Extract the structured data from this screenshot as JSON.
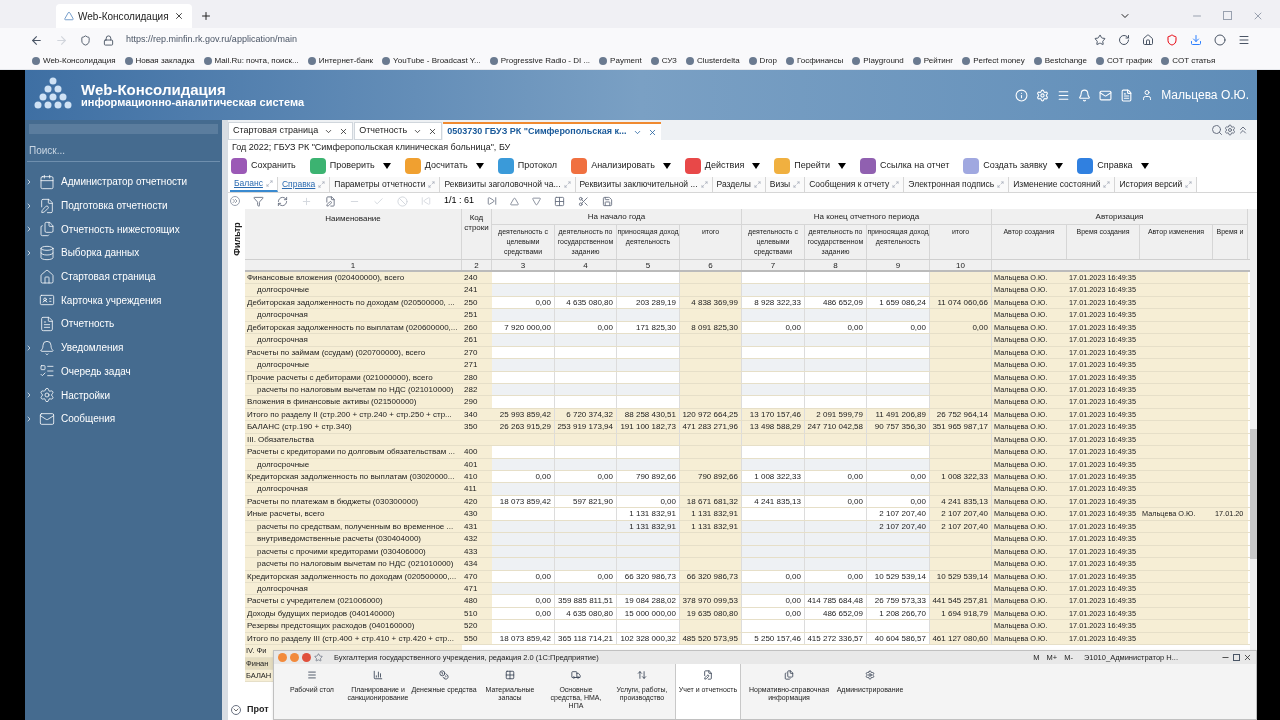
{
  "browser": {
    "tab_title": "Web-Консолидация",
    "url": "https://rep.minfin.rk.gov.ru/application/main",
    "bookmarks": [
      "Web-Консолидация",
      "Новая закладка",
      "Mail.Ru: почта, поиск...",
      "Интернет-банк",
      "YouTube - Broadcast Y...",
      "Progressive Radio - DI ...",
      "Payment",
      "СУЗ",
      "Clusterdelta",
      "Drop",
      "Госфинансы",
      "Playground",
      "Рейтинг",
      "Perfect money",
      "Bestchange",
      "СОТ график",
      "СОТ статья"
    ]
  },
  "app": {
    "title": "Web-Консолидация",
    "subtitle": "информационно-аналитическая система",
    "user": "Мальцева О.Ю."
  },
  "sidebar": {
    "search_placeholder": "Поиск...",
    "items": [
      {
        "label": "Администратор отчетности",
        "expanded": false
      },
      {
        "label": "Подготовка отчетности",
        "expanded": false
      },
      {
        "label": "Отчетность нижестоящих",
        "expanded": false
      },
      {
        "label": "Выборка данных",
        "expanded": false
      },
      {
        "label": "Стартовая страница"
      },
      {
        "label": "Карточка учреждения"
      },
      {
        "label": "Отчетность"
      },
      {
        "label": "Уведомления",
        "expanded": false
      },
      {
        "label": "Очередь задач"
      },
      {
        "label": "Настройки",
        "expanded": false
      },
      {
        "label": "Сообщения",
        "expanded": false
      }
    ]
  },
  "doc_tabs": [
    {
      "label": "Стартовая страница",
      "selected": false
    },
    {
      "label": "Отчетность",
      "selected": false
    },
    {
      "label": "0503730 ГБУЗ РК \"Симферопольская к...",
      "selected": true
    }
  ],
  "info": "Год 2022; ГБУЗ РК \"Симферопольская клиническая больница\", БУ",
  "toolbar": [
    {
      "label": "Сохранить",
      "color": "#9b59b6",
      "dropdown": false
    },
    {
      "label": "Проверить",
      "color": "#3cb371",
      "dropdown": true
    },
    {
      "label": "Досчитать",
      "color": "#f0a030",
      "dropdown": true
    },
    {
      "label": "Протокол",
      "color": "#3a9ad9",
      "dropdown": false
    },
    {
      "label": "Анализировать",
      "color": "#f07040",
      "dropdown": true
    },
    {
      "label": "Действия",
      "color": "#e84848",
      "dropdown": true
    },
    {
      "label": "Перейти",
      "color": "#f0b040",
      "dropdown": true
    },
    {
      "label": "Ссылка на отчет",
      "color": "#9060b0",
      "dropdown": false
    },
    {
      "label": "Создать заявку",
      "color": "#a0a8e0",
      "dropdown": true
    },
    {
      "label": "Справка",
      "color": "#3080e0",
      "dropdown": true
    }
  ],
  "form_tabs": [
    {
      "label": "Баланс",
      "kind": "link",
      "selected": true
    },
    {
      "label": "Справка",
      "kind": "link",
      "selected": false
    },
    {
      "label": "Параметры отчетности",
      "kind": "plain",
      "selected": false
    },
    {
      "label": "Реквизиты заголовочной ча...",
      "kind": "plain",
      "selected": false
    },
    {
      "label": "Реквизиты заключительной ...",
      "kind": "plain",
      "selected": false
    },
    {
      "label": "Разделы",
      "kind": "plain",
      "selected": false
    },
    {
      "label": "Визы",
      "kind": "plain",
      "selected": false
    },
    {
      "label": "Сообщения к отчету",
      "kind": "plain",
      "selected": false
    },
    {
      "label": "Электронная подпись",
      "kind": "plain",
      "selected": false
    },
    {
      "label": "Изменение состояний",
      "kind": "plain",
      "selected": false
    },
    {
      "label": "История версий",
      "kind": "plain",
      "selected": false
    }
  ],
  "pager": "1/1 : 61",
  "filter_label": "Фильтр",
  "table": {
    "name_header": "Наименование",
    "code_header": "Код строки",
    "groups": [
      {
        "label": "На начало года",
        "columns": [
          "деятельность с целевыми средствами",
          "деятельность по государственном заданию",
          "приносящая доход деятельность",
          "итого"
        ]
      },
      {
        "label": "На конец отчетного периода",
        "columns": [
          "деятельность с целевыми средствами",
          "деятельность по государственном заданию",
          "приносящая доход деятельность",
          "итого"
        ]
      },
      {
        "label": "Авторизация",
        "columns": [
          "Автор создания",
          "Время создания",
          "Автор изменения",
          "Время и"
        ]
      }
    ],
    "numbers": [
      "1",
      "2",
      "3",
      "4",
      "5",
      "6",
      "7",
      "8",
      "9",
      "10"
    ],
    "rows": [
      {
        "kind": "item",
        "name": "Финансовые вложения (020400000), всего",
        "code": "240",
        "author": "Мальцева О.Ю.",
        "created": "17.01.2023 16:49:35",
        "children": [
          {
            "kind": "item",
            "name": "долгосрочные",
            "code": "241",
            "author": "Мальцева О.Ю.",
            "created": "17.01.2023 16:49:35"
          }
        ]
      },
      {
        "kind": "item",
        "name": "Дебиторская задолженность по доходам (020500000, ...",
        "code": "250",
        "values": [
          "0,00",
          "4 635 080,80",
          "203 289,19",
          "4 838 369,99",
          "8 928 322,33",
          "486 652,09",
          "1 659 086,24",
          "11 074 060,66"
        ],
        "author": "Мальцева О.Ю.",
        "created": "17.01.2023 16:49:35",
        "children": [
          {
            "kind": "item",
            "name": "долгосрочная",
            "code": "251",
            "author": "Мальцева О.Ю.",
            "created": "17.01.2023 16:49:35"
          }
        ]
      },
      {
        "kind": "item",
        "name": "Дебиторская задолженность по выплатам (020600000,...",
        "code": "260",
        "values": [
          "7 920 000,00",
          "0,00",
          "171 825,30",
          "8 091 825,30",
          "0,00",
          "0,00",
          "0,00",
          "0,00"
        ],
        "author": "Мальцева О.Ю.",
        "created": "17.01.2023 16:49:35",
        "children": [
          {
            "kind": "item",
            "name": "долгосрочная",
            "code": "261",
            "author": "Мальцева О.Ю.",
            "created": "17.01.2023 16:49:35"
          }
        ]
      },
      {
        "kind": "item",
        "name": "Расчеты по займам (ссудам) (020700000), всего",
        "code": "270",
        "author": "Мальцева О.Ю.",
        "created": "17.01.2023 16:49:35",
        "children": [
          {
            "kind": "item",
            "name": "долгосрочные",
            "code": "271",
            "author": "Мальцева О.Ю.",
            "created": "17.01.2023 16:49:35"
          }
        ]
      },
      {
        "kind": "item",
        "name": "Прочие расчеты с дебиторами (021000000), всего",
        "code": "280",
        "author": "Мальцева О.Ю.",
        "created": "17.01.2023 16:49:35",
        "children": [
          {
            "kind": "item",
            "name": "расчеты по налоговым вычетам по НДС (021010000)",
            "code": "282",
            "author": "Мальцева О.Ю.",
            "created": "17.01.2023 16:49:35"
          }
        ]
      },
      {
        "kind": "item",
        "name": "Вложения в финансовые активы (021500000)",
        "code": "290",
        "author": "Мальцева О.Ю.",
        "created": "17.01.2023 16:49:35"
      },
      {
        "kind": "total",
        "name": "Итого по разделу II (стр.200 + стр.240 + стр.250 + стр...",
        "code": "340",
        "values": [
          "25 993 859,42",
          "6 720 374,32",
          "88 258 430,51",
          "120 972 664,25",
          "13 170 157,46",
          "2 091 599,79",
          "11 491 206,89",
          "26 752 964,14"
        ],
        "author": "Мальцева О.Ю.",
        "created": "17.01.2023 16:49:35"
      },
      {
        "kind": "total",
        "name": "БАЛАНС (стр.190 + стр.340)",
        "code": "350",
        "values": [
          "26 263 915,29",
          "253 919 173,94",
          "191 100 182,73",
          "471 283 271,96",
          "13 498 588,29",
          "247 710 042,58",
          "90 757 356,30",
          "351 965 987,17"
        ],
        "author": "Мальцева О.Ю.",
        "created": "17.01.2023 16:49:35"
      },
      {
        "kind": "total",
        "name": "III. Обязательства",
        "author": "Мальцева О.Ю.",
        "created": "17.01.2023 16:49:35"
      },
      {
        "kind": "item",
        "name": "Расчеты с кредиторами по долговым обязательствам ...",
        "code": "400",
        "author": "Мальцева О.Ю.",
        "created": "17.01.2023 16:49:35",
        "children": [
          {
            "kind": "item",
            "name": "долгосрочные",
            "code": "401",
            "author": "Мальцева О.Ю.",
            "created": "17.01.2023 16:49:35"
          }
        ]
      },
      {
        "kind": "item",
        "name": "Кредиторская задолженность по выплатам (03020000...",
        "code": "410",
        "values": [
          "0,00",
          "0,00",
          "790 892,66",
          "790 892,66",
          "1 008 322,33",
          "0,00",
          "0,00",
          "1 008 322,33"
        ],
        "author": "Мальцева О.Ю.",
        "created": "17.01.2023 16:49:35",
        "children": [
          {
            "kind": "item",
            "name": "долгосрочная",
            "code": "411",
            "author": "Мальцева О.Ю.",
            "created": "17.01.2023 16:49:35"
          }
        ]
      },
      {
        "kind": "item",
        "name": "Расчеты по платежам в бюджеты (030300000)",
        "code": "420",
        "values": [
          "18 073 859,42",
          "597 821,90",
          "0,00",
          "18 671 681,32",
          "4 241 835,13",
          "0,00",
          "0,00",
          "4 241 835,13"
        ],
        "author": "Мальцева О.Ю.",
        "created": "17.01.2023 16:49:35"
      },
      {
        "kind": "item",
        "name": "Иные расчеты, всего",
        "code": "430",
        "values": {
          "col_5": "1 131 832,91",
          "col_6": "1 131 832,91",
          "col_9": "2 107 207,40",
          "col_10": "2 107 207,40"
        },
        "author": "Мальцева О.Ю.",
        "created": "17.01.2023 16:49:35",
        "modified_by": "Мальцева О.Ю.",
        "modified_at": "17.01.20",
        "children": [
          {
            "kind": "item",
            "name": "расчеты по средствам, полученным во временное ...",
            "code": "431",
            "values": {
              "col_5": "1 131 832,91",
              "col_6": "1 131 832,91",
              "col_9": "2 107 207,40",
              "col_10": "2 107 207,40"
            },
            "author": "Мальцева О.Ю.",
            "created": "17.01.2023 16:49:35"
          },
          {
            "kind": "item",
            "name": "внутриведомственные расчеты (030404000)",
            "code": "432",
            "author": "Мальцева О.Ю.",
            "created": "17.01.2023 16:49:35"
          },
          {
            "kind": "item",
            "name": "расчеты с прочими кредиторами (030406000)",
            "code": "433",
            "author": "Мальцева О.Ю.",
            "created": "17.01.2023 16:49:35"
          },
          {
            "kind": "item",
            "name": "расчеты по налоговым вычетам по НДС (021010000)",
            "code": "434",
            "author": "Мальцева О.Ю.",
            "created": "17.01.2023 16:49:35"
          }
        ]
      },
      {
        "kind": "item",
        "name": "Кредиторская задолженность по доходам (020500000,...",
        "code": "470",
        "values": [
          "0,00",
          "0,00",
          "66 320 986,73",
          "66 320 986,73",
          "0,00",
          "0,00",
          "10 529 539,14",
          "10 529 539,14"
        ],
        "author": "Мальцева О.Ю.",
        "created": "17.01.2023 16:49:35",
        "children": [
          {
            "kind": "item",
            "name": "долгосрочная",
            "code": "471",
            "author": "Мальцева О.Ю.",
            "created": "17.01.2023 16:49:35"
          }
        ]
      },
      {
        "kind": "item",
        "name": "Расчеты с учредителем (021006000)",
        "code": "480",
        "values": [
          "0,00",
          "359 885 811,51",
          "19 084 288,02",
          "378 970 099,53",
          "0,00",
          "414 785 684,48",
          "26 759 573,33",
          "441 545 257,81"
        ],
        "author": "Мальцева О.Ю.",
        "created": "17.01.2023 16:49:35"
      },
      {
        "kind": "item",
        "name": "Доходы будущих периодов (040140000)",
        "code": "510",
        "values": [
          "0,00",
          "4 635 080,80",
          "15 000 000,00",
          "19 635 080,80",
          "0,00",
          "486 652,09",
          "1 208 266,70",
          "1 694 918,79"
        ],
        "author": "Мальцева О.Ю.",
        "created": "17.01.2023 16:49:35"
      },
      {
        "kind": "item",
        "name": "Резервы предстоящих расходов (040160000)",
        "code": "520",
        "author": "Мальцева О.Ю.",
        "created": "17.01.2023 16:49:35"
      },
      {
        "kind": "item",
        "name": "Итого по разделу III (стр.400 + стр.410 + стр.420 + стр...",
        "code": "550",
        "values": [
          "18 073 859,42",
          "365 118 714,21",
          "102 328 000,32",
          "485 520 573,95",
          "5 250 157,46",
          "415 272 336,57",
          "40 604 586,57",
          "461 127 080,60"
        ],
        "author": "Мальцева О.Ю.",
        "created": "17.01.2023 16:49:35"
      }
    ],
    "peek_rows": [
      "IV. Фи",
      "Финан",
      "БАЛАН"
    ]
  },
  "bottom_panel": "Прот",
  "overlay": {
    "title": "Бухгалтерия государственного учреждения, редакция 2.0 (1С:Предприятие)",
    "memory_buttons": [
      "M",
      "M+",
      "M-"
    ],
    "user": "Э1010_Администратор Н...",
    "sections": [
      {
        "label": "Рабочий стол",
        "selected": false
      },
      {
        "label": "Планирование и санкционирование",
        "selected": false
      },
      {
        "label": "Денежные средства",
        "selected": false
      },
      {
        "label": "Материальные запасы",
        "selected": false
      },
      {
        "label": "Основные средства, НМА, НПА",
        "selected": false
      },
      {
        "label": "Услуги, работы, производство",
        "selected": false
      },
      {
        "label": "Учет и отчетность",
        "selected": true
      },
      {
        "label": "Нормативно-справочная информация",
        "selected": false
      },
      {
        "label": "Администрирование",
        "selected": false
      }
    ]
  }
}
